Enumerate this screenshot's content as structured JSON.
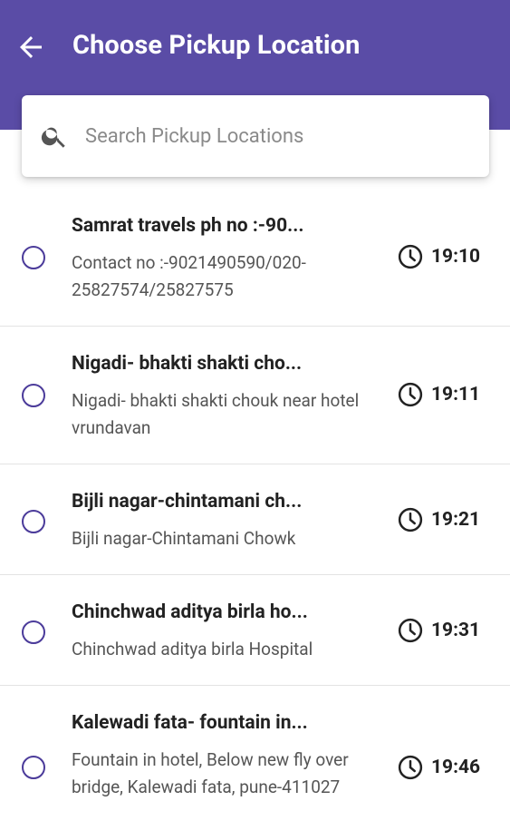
{
  "header": {
    "title": "Choose Pickup Location",
    "back_icon": "arrow-left-icon"
  },
  "search": {
    "placeholder": "Search Pickup Locations",
    "icon": "search-icon"
  },
  "colors": {
    "header_bg": "#5a4ca6",
    "radio_accent": "#4b3b9a"
  },
  "locations": [
    {
      "name": "Samrat travels ph no :-90...",
      "address": "Contact no :-9021490590/020-25827574/25827575",
      "time": "19:10"
    },
    {
      "name": "Nigadi- bhakti shakti cho...",
      "address": "Nigadi- bhakti shakti chouk near hotel vrundavan",
      "time": "19:11"
    },
    {
      "name": "Bijli nagar-chintamani ch...",
      "address": "Bijli nagar-Chintamani Chowk",
      "time": "19:21"
    },
    {
      "name": "Chinchwad aditya birla ho...",
      "address": "Chinchwad aditya birla Hospital",
      "time": "19:31"
    },
    {
      "name": "Kalewadi fata- fountain in...",
      "address": "Fountain in hotel, Below new fly over bridge, Kalewadi fata, pune-411027",
      "time": "19:46"
    }
  ]
}
